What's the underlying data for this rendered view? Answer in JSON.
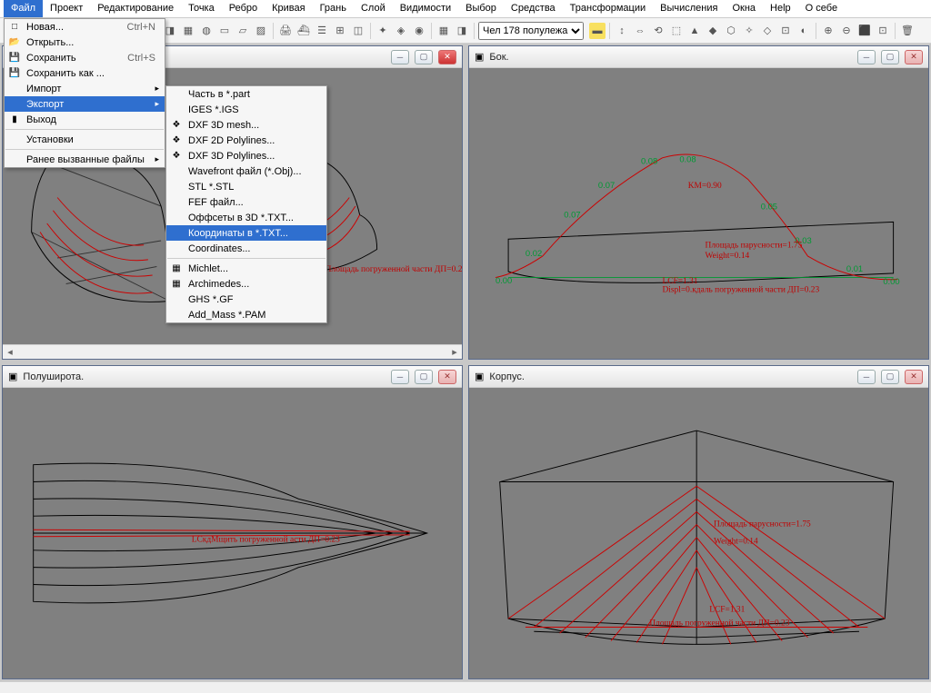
{
  "menubar": [
    "Файл",
    "Проект",
    "Редактирование",
    "Точка",
    "Ребро",
    "Кривая",
    "Грань",
    "Слой",
    "Видимости",
    "Выбор",
    "Средства",
    "Трансформации",
    "Вычисления",
    "Окна",
    "Help",
    "О себе"
  ],
  "menubar_active": 0,
  "toolbar_combo": "Чел 178 полулежа",
  "file_menu": [
    {
      "label": "Новая...",
      "icon": "□",
      "shortcut": "Ctrl+N"
    },
    {
      "label": "Открыть...",
      "icon": "📂"
    },
    {
      "label": "Сохранить",
      "icon": "💾",
      "shortcut": "Ctrl+S"
    },
    {
      "label": "Сохранить как ...",
      "icon": "💾"
    },
    {
      "label": "Импорт",
      "sub": true
    },
    {
      "label": "Экспорт",
      "sub": true,
      "selected": true
    },
    {
      "label": "Выход",
      "icon": "▮"
    },
    {
      "sep": true
    },
    {
      "label": "Установки"
    },
    {
      "sep": true
    },
    {
      "label": "Ранее вызванные файлы",
      "sub": true
    }
  ],
  "export_menu": [
    {
      "label": "Часть в *.part"
    },
    {
      "label": "IGES *.IGS"
    },
    {
      "label": "DXF 3D mesh...",
      "icon": "❖"
    },
    {
      "label": "DXF 2D Polylines...",
      "icon": "❖"
    },
    {
      "label": "DXF 3D Polylines...",
      "icon": "❖"
    },
    {
      "label": "Wavefront файл (*.Obj)..."
    },
    {
      "label": "STL *.STL"
    },
    {
      "label": "FEF файл..."
    },
    {
      "label": "Оффсеты в 3D *.TXT..."
    },
    {
      "label": "Координаты в *.TXT...",
      "selected": true
    },
    {
      "label": "Coordinates..."
    },
    {
      "sep": true
    },
    {
      "label": "Michlet...",
      "icon": "▦"
    },
    {
      "label": "Archimedes...",
      "icon": "▦"
    },
    {
      "label": "GHS *.GF"
    },
    {
      "label": "Add_Mass *.PAM"
    }
  ],
  "panes": {
    "tl": {
      "title": ""
    },
    "tr": {
      "title": "Бок."
    },
    "bl": {
      "title": "Полуширота."
    },
    "br": {
      "title": "Корпус."
    }
  },
  "annotations": {
    "tr": {
      "dp": "Displ=0.кдаль погруженной части ДП=0.23",
      "sail": "Площадь парусности=1.75",
      "weight": "Weight=0.14",
      "km": "KM=0.90",
      "lcf": "LCF=1.31",
      "pts": [
        "0.00",
        "0.02",
        "0.07",
        "0.08",
        "0.08",
        "0.07",
        "0.05",
        "0.03",
        "0.01",
        "0.00"
      ],
      "a07": "0.07",
      "a08a": "0.08",
      "a08b": "0.08",
      "a05": "0.05",
      "a03": "0.03",
      "a01": "0.01",
      "a00r": "0.00",
      "a07l": "0.07",
      "a02": "0.02",
      "a00l": "0.00"
    },
    "bl": {
      "line": "LCкдMщить погруженной асти ДП=0.23"
    },
    "br": {
      "sail": "Площадь парусности=1.75",
      "weight": "Weight=0.14",
      "lcf": "LCF=1.31",
      "dp": "Площадь погруженной части ДП=0.23"
    }
  }
}
